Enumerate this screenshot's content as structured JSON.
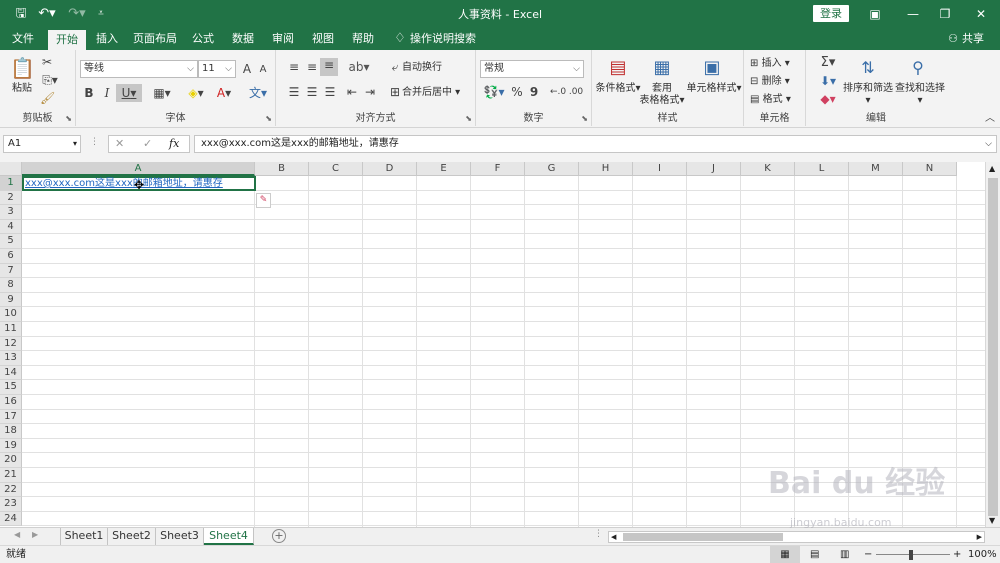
{
  "window": {
    "title": "人事资料 - Excel",
    "login_label": "登录"
  },
  "tabs": [
    {
      "label": "文件"
    },
    {
      "label": "开始"
    },
    {
      "label": "插入"
    },
    {
      "label": "页面布局"
    },
    {
      "label": "公式"
    },
    {
      "label": "数据"
    },
    {
      "label": "审阅"
    },
    {
      "label": "视图"
    },
    {
      "label": "帮助"
    }
  ],
  "search": {
    "label": "操作说明搜索"
  },
  "share": {
    "label": "共享"
  },
  "ribbon": {
    "clipboard": {
      "group": "剪贴板",
      "paste": "粘贴"
    },
    "font": {
      "group": "字体",
      "name": "等线",
      "size": "11",
      "inc": "A",
      "dec": "A",
      "bold": "B",
      "italic": "I",
      "underline": "U"
    },
    "alignment": {
      "group": "对齐方式",
      "wrap": "自动换行",
      "merge": "合并后居中"
    },
    "number": {
      "group": "数字",
      "format": "常规",
      "percent": "%",
      "comma": "9"
    },
    "styles": {
      "group": "样式",
      "conditional": "条件格式",
      "table1": "套用",
      "table2": "表格格式",
      "cell": "单元格样式"
    },
    "cells": {
      "group": "单元格",
      "insert": "插入",
      "delete": "删除",
      "format": "格式"
    },
    "editing": {
      "group": "编辑",
      "sort": "排序和筛选",
      "find": "查找和选择",
      "sigma": "Σ"
    }
  },
  "formula_bar": {
    "name_box": "A1",
    "fx": "fx",
    "content": "xxx@xxx.com这是xxx的邮箱地址，请惠存"
  },
  "grid": {
    "columns": [
      "A",
      "B",
      "C",
      "D",
      "E",
      "F",
      "G",
      "H",
      "I",
      "J",
      "K",
      "L",
      "M",
      "N"
    ],
    "rows": [
      "1",
      "2",
      "3",
      "4",
      "5",
      "6",
      "7",
      "8",
      "9",
      "10",
      "11",
      "12",
      "13",
      "14",
      "15",
      "16",
      "17",
      "18",
      "19",
      "20",
      "21",
      "22",
      "23",
      "24"
    ],
    "a1": "xxx@xxx.com这是xxx的邮箱地址，请惠存"
  },
  "sheets": [
    {
      "label": "Sheet1"
    },
    {
      "label": "Sheet2"
    },
    {
      "label": "Sheet3"
    },
    {
      "label": "Sheet4"
    }
  ],
  "status": {
    "ready": "就绪",
    "zoom": "100%"
  },
  "watermark": {
    "brand": "Bai  du 经验",
    "url": "jingyan.baidu.com"
  }
}
